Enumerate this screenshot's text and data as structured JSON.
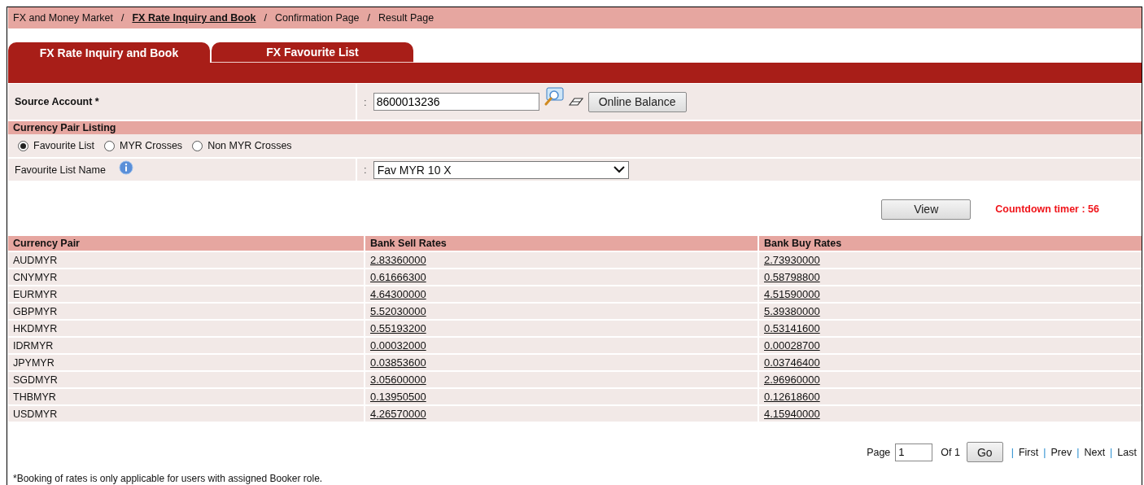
{
  "breadcrumb": {
    "separator": "/",
    "items": [
      {
        "label": "FX and Money Market",
        "current": false
      },
      {
        "label": "FX Rate Inquiry and Book",
        "current": true
      },
      {
        "label": "Confirmation Page",
        "current": false
      },
      {
        "label": "Result Page",
        "current": false
      }
    ]
  },
  "tabs": [
    {
      "label": "FX Rate Inquiry and Book",
      "selected": true
    },
    {
      "label": "FX Favourite List",
      "selected": false
    }
  ],
  "source_account": {
    "label": "Source Account *",
    "colon": ":",
    "value": "8600013236",
    "button": "Online Balance"
  },
  "currency_pair_listing": {
    "title": "Currency Pair Listing",
    "options": [
      {
        "label": "Favourite List",
        "selected": true
      },
      {
        "label": "MYR Crosses",
        "selected": false
      },
      {
        "label": "Non MYR Crosses",
        "selected": false
      }
    ]
  },
  "favourite_list_name": {
    "label": "Favourite List Name",
    "colon": ":",
    "value": "Fav MYR 10 X"
  },
  "view_button": "View",
  "countdown": "Countdown timer : 56",
  "table": {
    "columns": [
      "Currency Pair",
      "Bank Sell Rates",
      "Bank Buy Rates"
    ],
    "rows": [
      [
        "AUDMYR",
        "2.83360000",
        "2.73930000"
      ],
      [
        "CNYMYR",
        "0.61666300",
        "0.58798800"
      ],
      [
        "EURMYR",
        "4.64300000",
        "4.51590000"
      ],
      [
        "GBPMYR",
        "5.52030000",
        "5.39380000"
      ],
      [
        "HKDMYR",
        "0.55193200",
        "0.53141600"
      ],
      [
        "IDRMYR",
        "0.00032000",
        "0.00028700"
      ],
      [
        "JPYMYR",
        "0.03853600",
        "0.03746400"
      ],
      [
        "SGDMYR",
        "3.05600000",
        "2.96960000"
      ],
      [
        "THBMYR",
        "0.13950500",
        "0.12618600"
      ],
      [
        "USDMYR",
        "4.26570000",
        "4.15940000"
      ]
    ]
  },
  "pagination": {
    "page_label": "Page",
    "page": "1",
    "of": "Of 1",
    "go": "Go",
    "separator": "|",
    "links": [
      "First",
      "Prev",
      "Next",
      "Last"
    ]
  },
  "footnote": "*Booking of rates is only applicable for users with assigned Booker role."
}
